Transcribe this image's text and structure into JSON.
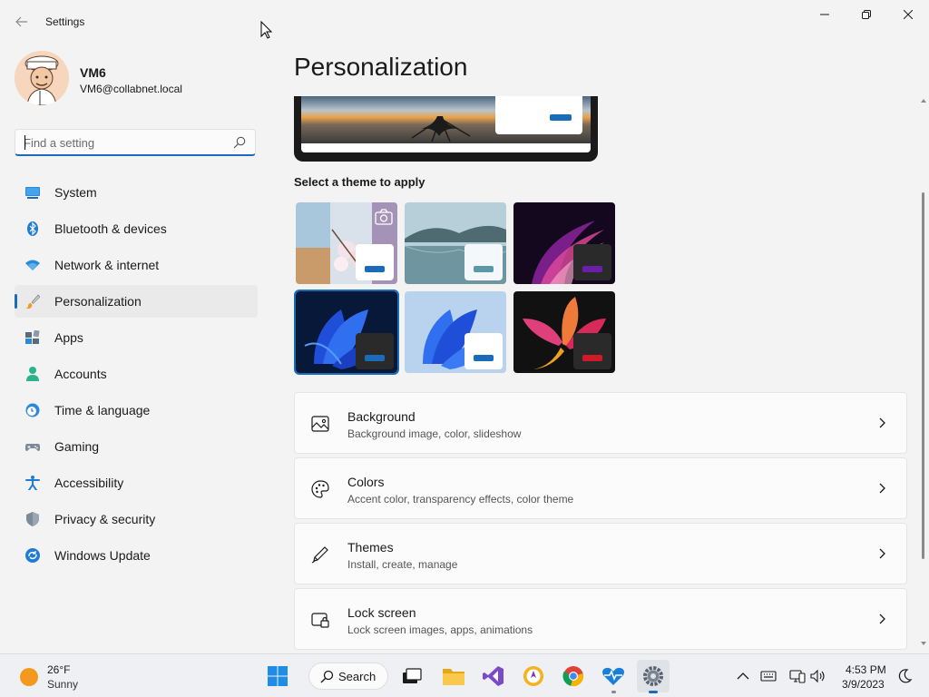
{
  "window": {
    "title": "Settings"
  },
  "user": {
    "name": "VM6",
    "email": "VM6@collabnet.local"
  },
  "search": {
    "placeholder": "Find a setting"
  },
  "sidebar": {
    "items": [
      {
        "label": "System",
        "icon": "system-icon"
      },
      {
        "label": "Bluetooth & devices",
        "icon": "bluetooth-icon"
      },
      {
        "label": "Network & internet",
        "icon": "wifi-icon"
      },
      {
        "label": "Personalization",
        "icon": "brush-icon",
        "selected": true
      },
      {
        "label": "Apps",
        "icon": "apps-icon"
      },
      {
        "label": "Accounts",
        "icon": "person-icon"
      },
      {
        "label": "Time & language",
        "icon": "clock-globe-icon"
      },
      {
        "label": "Gaming",
        "icon": "gamepad-icon"
      },
      {
        "label": "Accessibility",
        "icon": "accessibility-icon"
      },
      {
        "label": "Privacy & security",
        "icon": "shield-icon"
      },
      {
        "label": "Windows Update",
        "icon": "update-icon"
      }
    ]
  },
  "main": {
    "page_title": "Personalization",
    "themes_label": "Select a theme to apply",
    "cards": [
      {
        "title": "Background",
        "subtitle": "Background image, color, slideshow",
        "icon": "image-icon"
      },
      {
        "title": "Colors",
        "subtitle": "Accent color, transparency effects, color theme",
        "icon": "palette-icon"
      },
      {
        "title": "Themes",
        "subtitle": "Install, create, manage",
        "icon": "pen-icon"
      },
      {
        "title": "Lock screen",
        "subtitle": "Lock screen images, apps, animations",
        "icon": "lock-screen-icon"
      }
    ]
  },
  "taskbar": {
    "weather_temp": "26°F",
    "weather_desc": "Sunny",
    "search_label": "Search",
    "clock_time": "4:53 PM",
    "clock_date": "3/9/2023"
  },
  "colors": {
    "accent": "#1a6bb8",
    "window_bg": "#f3f3f3",
    "card_bg": "#fbfbfb"
  }
}
